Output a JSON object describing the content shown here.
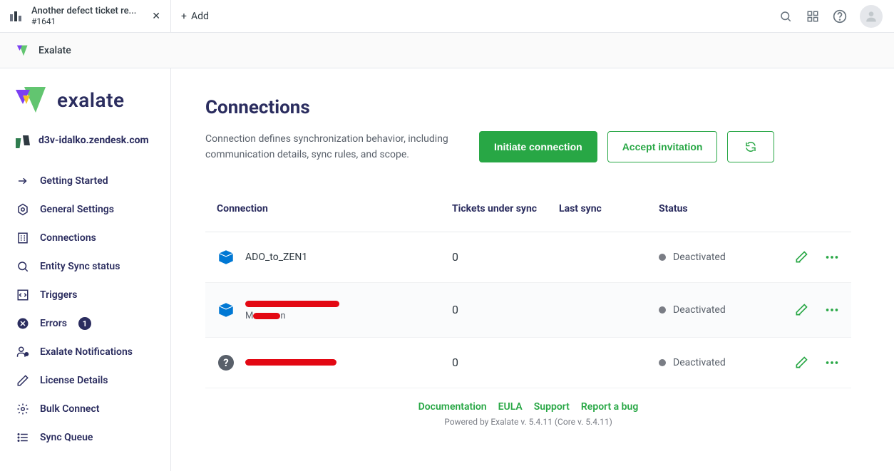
{
  "topbar": {
    "tab_title": "Another defect ticket re...",
    "tab_sub": "#1641",
    "add_label": "Add"
  },
  "exbar": {
    "label": "Exalate"
  },
  "sidebar": {
    "brand": "exalate",
    "workspace": "d3v-idalko.zendesk.com",
    "nav": [
      {
        "label": "Getting Started"
      },
      {
        "label": "General Settings"
      },
      {
        "label": "Connections"
      },
      {
        "label": "Entity Sync status"
      },
      {
        "label": "Triggers"
      },
      {
        "label": "Errors",
        "badge": "1"
      },
      {
        "label": "Exalate Notifications"
      },
      {
        "label": "License Details"
      },
      {
        "label": "Bulk Connect"
      },
      {
        "label": "Sync Queue"
      }
    ]
  },
  "page": {
    "title": "Connections",
    "description": "Connection defines synchronization behavior, including communication details, sync rules, and scope.",
    "initiate_label": "Initiate connection",
    "accept_label": "Accept invitation"
  },
  "table": {
    "headers": {
      "connection": "Connection",
      "tickets": "Tickets under sync",
      "last": "Last sync",
      "status": "Status"
    },
    "rows": [
      {
        "name": "ADO_to_ZEN1",
        "tickets": "0",
        "status": "Deactivated",
        "icon": "ado"
      },
      {
        "name_redacted": true,
        "tickets": "0",
        "status": "Deactivated",
        "icon": "ado"
      },
      {
        "name_redacted": true,
        "tickets": "0",
        "status": "Deactivated",
        "icon": "question"
      }
    ]
  },
  "footer": {
    "links": [
      "Documentation",
      "EULA",
      "Support",
      "Report a bug"
    ],
    "powered": "Powered by Exalate v. 5.4.11 (Core v. 5.4.11)"
  }
}
